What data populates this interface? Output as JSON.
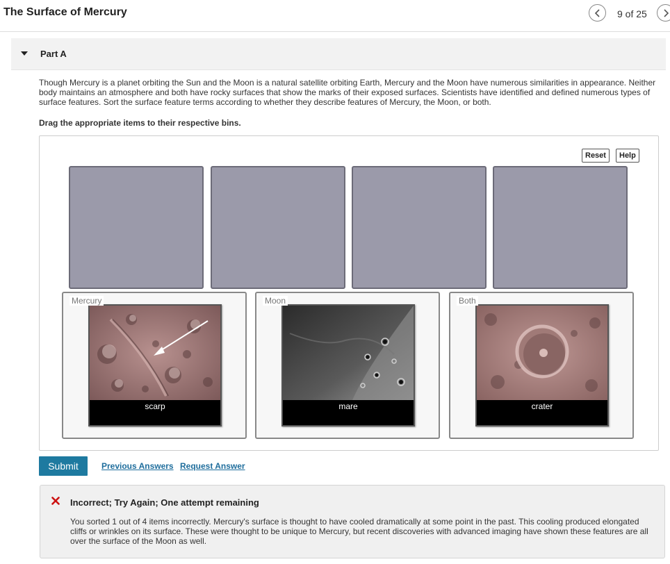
{
  "header": {
    "title": "The Surface of Mercury",
    "page_counter": "9 of 25",
    "prev_icon": "chevron-left-icon",
    "next_icon": "chevron-right-icon"
  },
  "part": {
    "label": "Part A",
    "expanded": true
  },
  "prompt": "Though Mercury is a planet orbiting the Sun and the Moon is a natural satellite orbiting Earth, Mercury and the Moon have numerous similarities in appearance. Neither body maintains an atmosphere and both have rocky surfaces that show the marks of their exposed surfaces. Scientists have identified and defined numerous types of surface features. Sort the surface feature terms according to whether they describe features of Mercury, the Moon, or both.",
  "instruction": "Drag the appropriate items to their respective bins.",
  "workspace": {
    "reset_label": "Reset",
    "help_label": "Help",
    "empty_slots": 4,
    "bins": [
      {
        "label": "Mercury",
        "item": {
          "label": "scarp",
          "image": "mercury-scarp-photo"
        }
      },
      {
        "label": "Moon",
        "item": {
          "label": "mare",
          "image": "moon-mare-photo"
        }
      },
      {
        "label": "Both",
        "item": {
          "label": "crater",
          "image": "crater-photo"
        }
      }
    ]
  },
  "actions": {
    "submit_label": "Submit",
    "previous_answers_label": "Previous Answers",
    "request_answer_label": "Request Answer"
  },
  "feedback": {
    "icon": "incorrect-x-icon",
    "title": "Incorrect; Try Again; One attempt remaining",
    "body": "You sorted 1 out of 4 items incorrectly. Mercury's surface is thought to have cooled dramatically at some point in the past. This cooling produced elongated cliffs or wrinkles on its surface. These were thought to be unique to Mercury, but recent discoveries with advanced imaging have shown these features are all over the surface of the Moon as well."
  },
  "colors": {
    "accent": "#1e7aa0",
    "slot_fill": "#9b9aaa",
    "error": "#cc1111"
  }
}
